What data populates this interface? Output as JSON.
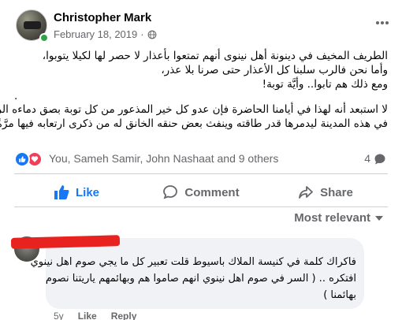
{
  "post": {
    "author": "Christopher Mark",
    "date": "February 18, 2019",
    "separator": "·",
    "audience_icon": "globe-icon",
    "more_icon": "more-horizontal-icon",
    "lines": [
      "الطريف المخيف في دينونة أهل نينوى أنهم تمتعوا بأعذار لا حصر لها لكيلا يتوبوا،",
      "وأما نحن فالرب سلبنا كل الأعذار حتى صرنا بلا عذر،",
      "ومع ذلك هم تابوا.. وأيَّة توبة!"
    ],
    "dot": ".",
    "lines2": [
      "لا استبعد أنه لهذا في أيامنا الحاضرة فإن عدو كل خير المذعور من كل توبة بصق دماءه الرديّة",
      "في هذه المدينة ليدمرها قدر طاقته وينفث بعض حنقه الخانق له من ذكرى ارتعابه فيها مرَّةً.."
    ]
  },
  "reactions": {
    "names": "You, Sameh Samir, John Nashaat and 9 others",
    "comment_count": "4",
    "icons": [
      "like-reaction-icon",
      "love-reaction-icon"
    ],
    "colors": {
      "like": "#1877f2",
      "love": "#f33e58"
    }
  },
  "actions": {
    "like": "Like",
    "comment": "Comment",
    "share": "Share"
  },
  "sort": {
    "label": "Most relevant"
  },
  "comment": {
    "lines": [
      "فاكراك كلمة في كنيسة الملاك باسيوط قلت تعبير كل ما يجي صوم اهل نينوي",
      "افتكره .. ( السر في صوم اهل نينوي انهم صاموا هم وبهائمهم ياريتنا نصوم",
      "بهائمنا )"
    ],
    "time": "5y",
    "like": "Like",
    "reply": "Reply"
  },
  "colors": {
    "accent": "#1877f2",
    "secondary_text": "#65676b",
    "online": "#31a24c",
    "redaction": "#e8231f"
  }
}
